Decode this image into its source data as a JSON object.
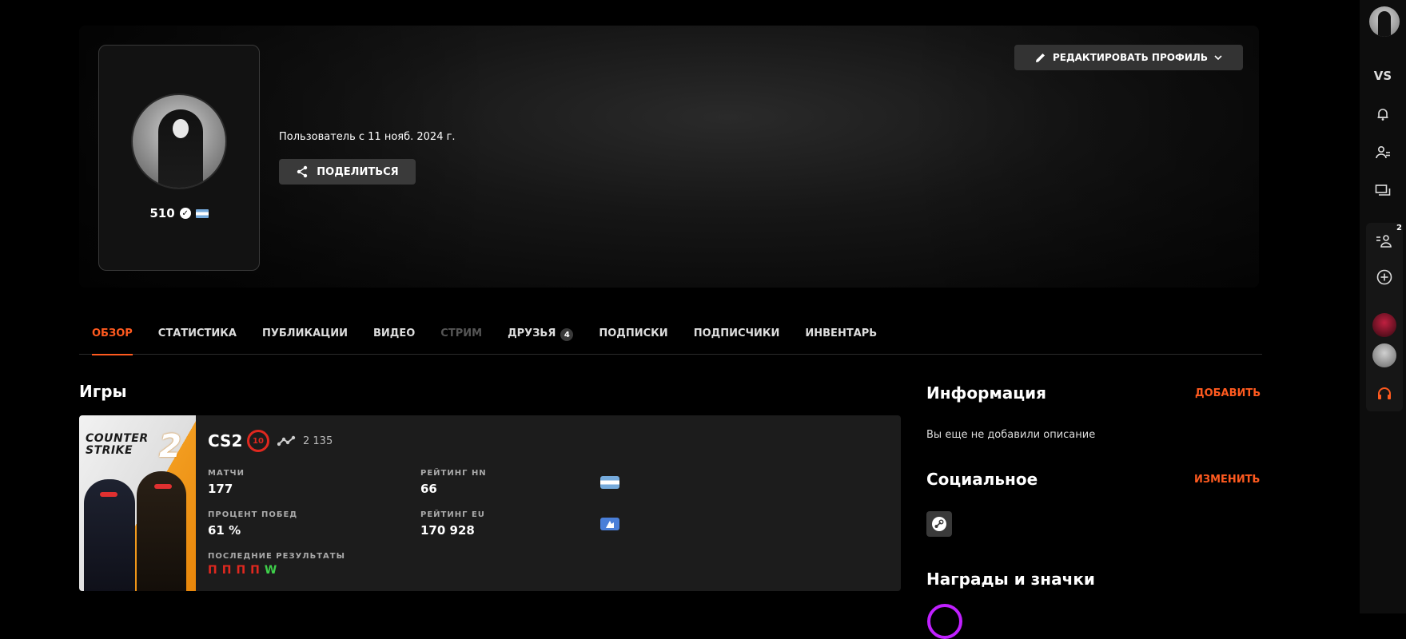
{
  "profile": {
    "nickname": "510",
    "member_since": "Пользователь с 11 нояб. 2024 г.",
    "share_label": "ПОДЕЛИТЬСЯ",
    "edit_label": "РЕДАКТИРОВАТЬ ПРОФИЛЬ"
  },
  "tabs": [
    {
      "label": "ОБЗОР",
      "state": "active"
    },
    {
      "label": "СТАТИСТИКА"
    },
    {
      "label": "ПУБЛИКАЦИИ"
    },
    {
      "label": "ВИДЕО"
    },
    {
      "label": "СТРИМ",
      "state": "disabled"
    },
    {
      "label": "ДРУЗЬЯ",
      "count": "4"
    },
    {
      "label": "ПОДПИСКИ"
    },
    {
      "label": "ПОДПИСЧИКИ"
    },
    {
      "label": "ИНВЕНТАРЬ"
    }
  ],
  "games": {
    "title": "Игры",
    "card": {
      "cover_text": "COUNTER STRIKE",
      "cover_number": "2",
      "name": "CS2",
      "level": "10",
      "elo": "2 135",
      "stats": {
        "matches_label": "МАТЧИ",
        "matches_value": "177",
        "winrate_label": "ПРОЦЕНТ ПОБЕД",
        "winrate_value": "61 %",
        "rating_hn_label": "РЕЙТИНГ HN",
        "rating_hn_value": "66",
        "rating_eu_label": "РЕЙТИНГ EU",
        "rating_eu_value": "170 928",
        "recent_label": "ПОСЛЕДНИЕ РЕЗУЛЬТАТЫ",
        "recent": [
          "П",
          "П",
          "П",
          "П",
          "W"
        ]
      }
    }
  },
  "info": {
    "title": "Информация",
    "add_label": "ДОБАВИТЬ",
    "description": "Вы еще не добавили описание"
  },
  "social": {
    "title": "Социальное",
    "change_label": "ИЗМЕНИТЬ"
  },
  "awards": {
    "title": "Награды и значки"
  },
  "rail": {
    "vs_label": "VS",
    "party_badge": "2"
  },
  "colors": {
    "accent": "#ff5a1f",
    "loss": "#e0281f",
    "win": "#3ecf4a"
  }
}
